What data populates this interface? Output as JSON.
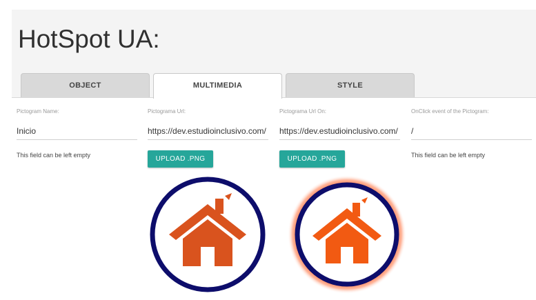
{
  "page": {
    "title": "HotSpot UA:"
  },
  "tabs": [
    {
      "label": "OBJECT",
      "active": false
    },
    {
      "label": "MULTIMEDIA",
      "active": true
    },
    {
      "label": "STYLE",
      "active": false
    }
  ],
  "fields": {
    "pictogram_name": {
      "label": "Pictogram Name:",
      "value": "Inicio",
      "hint": "This field can be left empty"
    },
    "pictogram_url": {
      "label": "Pictograma Url:",
      "value": "https://dev.estudioinclusivo.com/"
    },
    "pictogram_url_on": {
      "label": "Pictograma Url On:",
      "value": "https://dev.estudioinclusivo.com/"
    },
    "onclick_event": {
      "label": "OnClick event of the Pictogram:",
      "value": "/",
      "hint": "This field can be left empty"
    }
  },
  "buttons": {
    "upload_label": "UPLOAD .PNG"
  },
  "pictograms": {
    "normal_icon": "house-icon",
    "hover_icon": "house-icon",
    "ring_color": "#0d0d6b",
    "house_color": "#d9531e",
    "house_color_on": "#f25a12",
    "glow_color": "#ff5a1f"
  },
  "colors": {
    "accent": "#26a69a"
  }
}
